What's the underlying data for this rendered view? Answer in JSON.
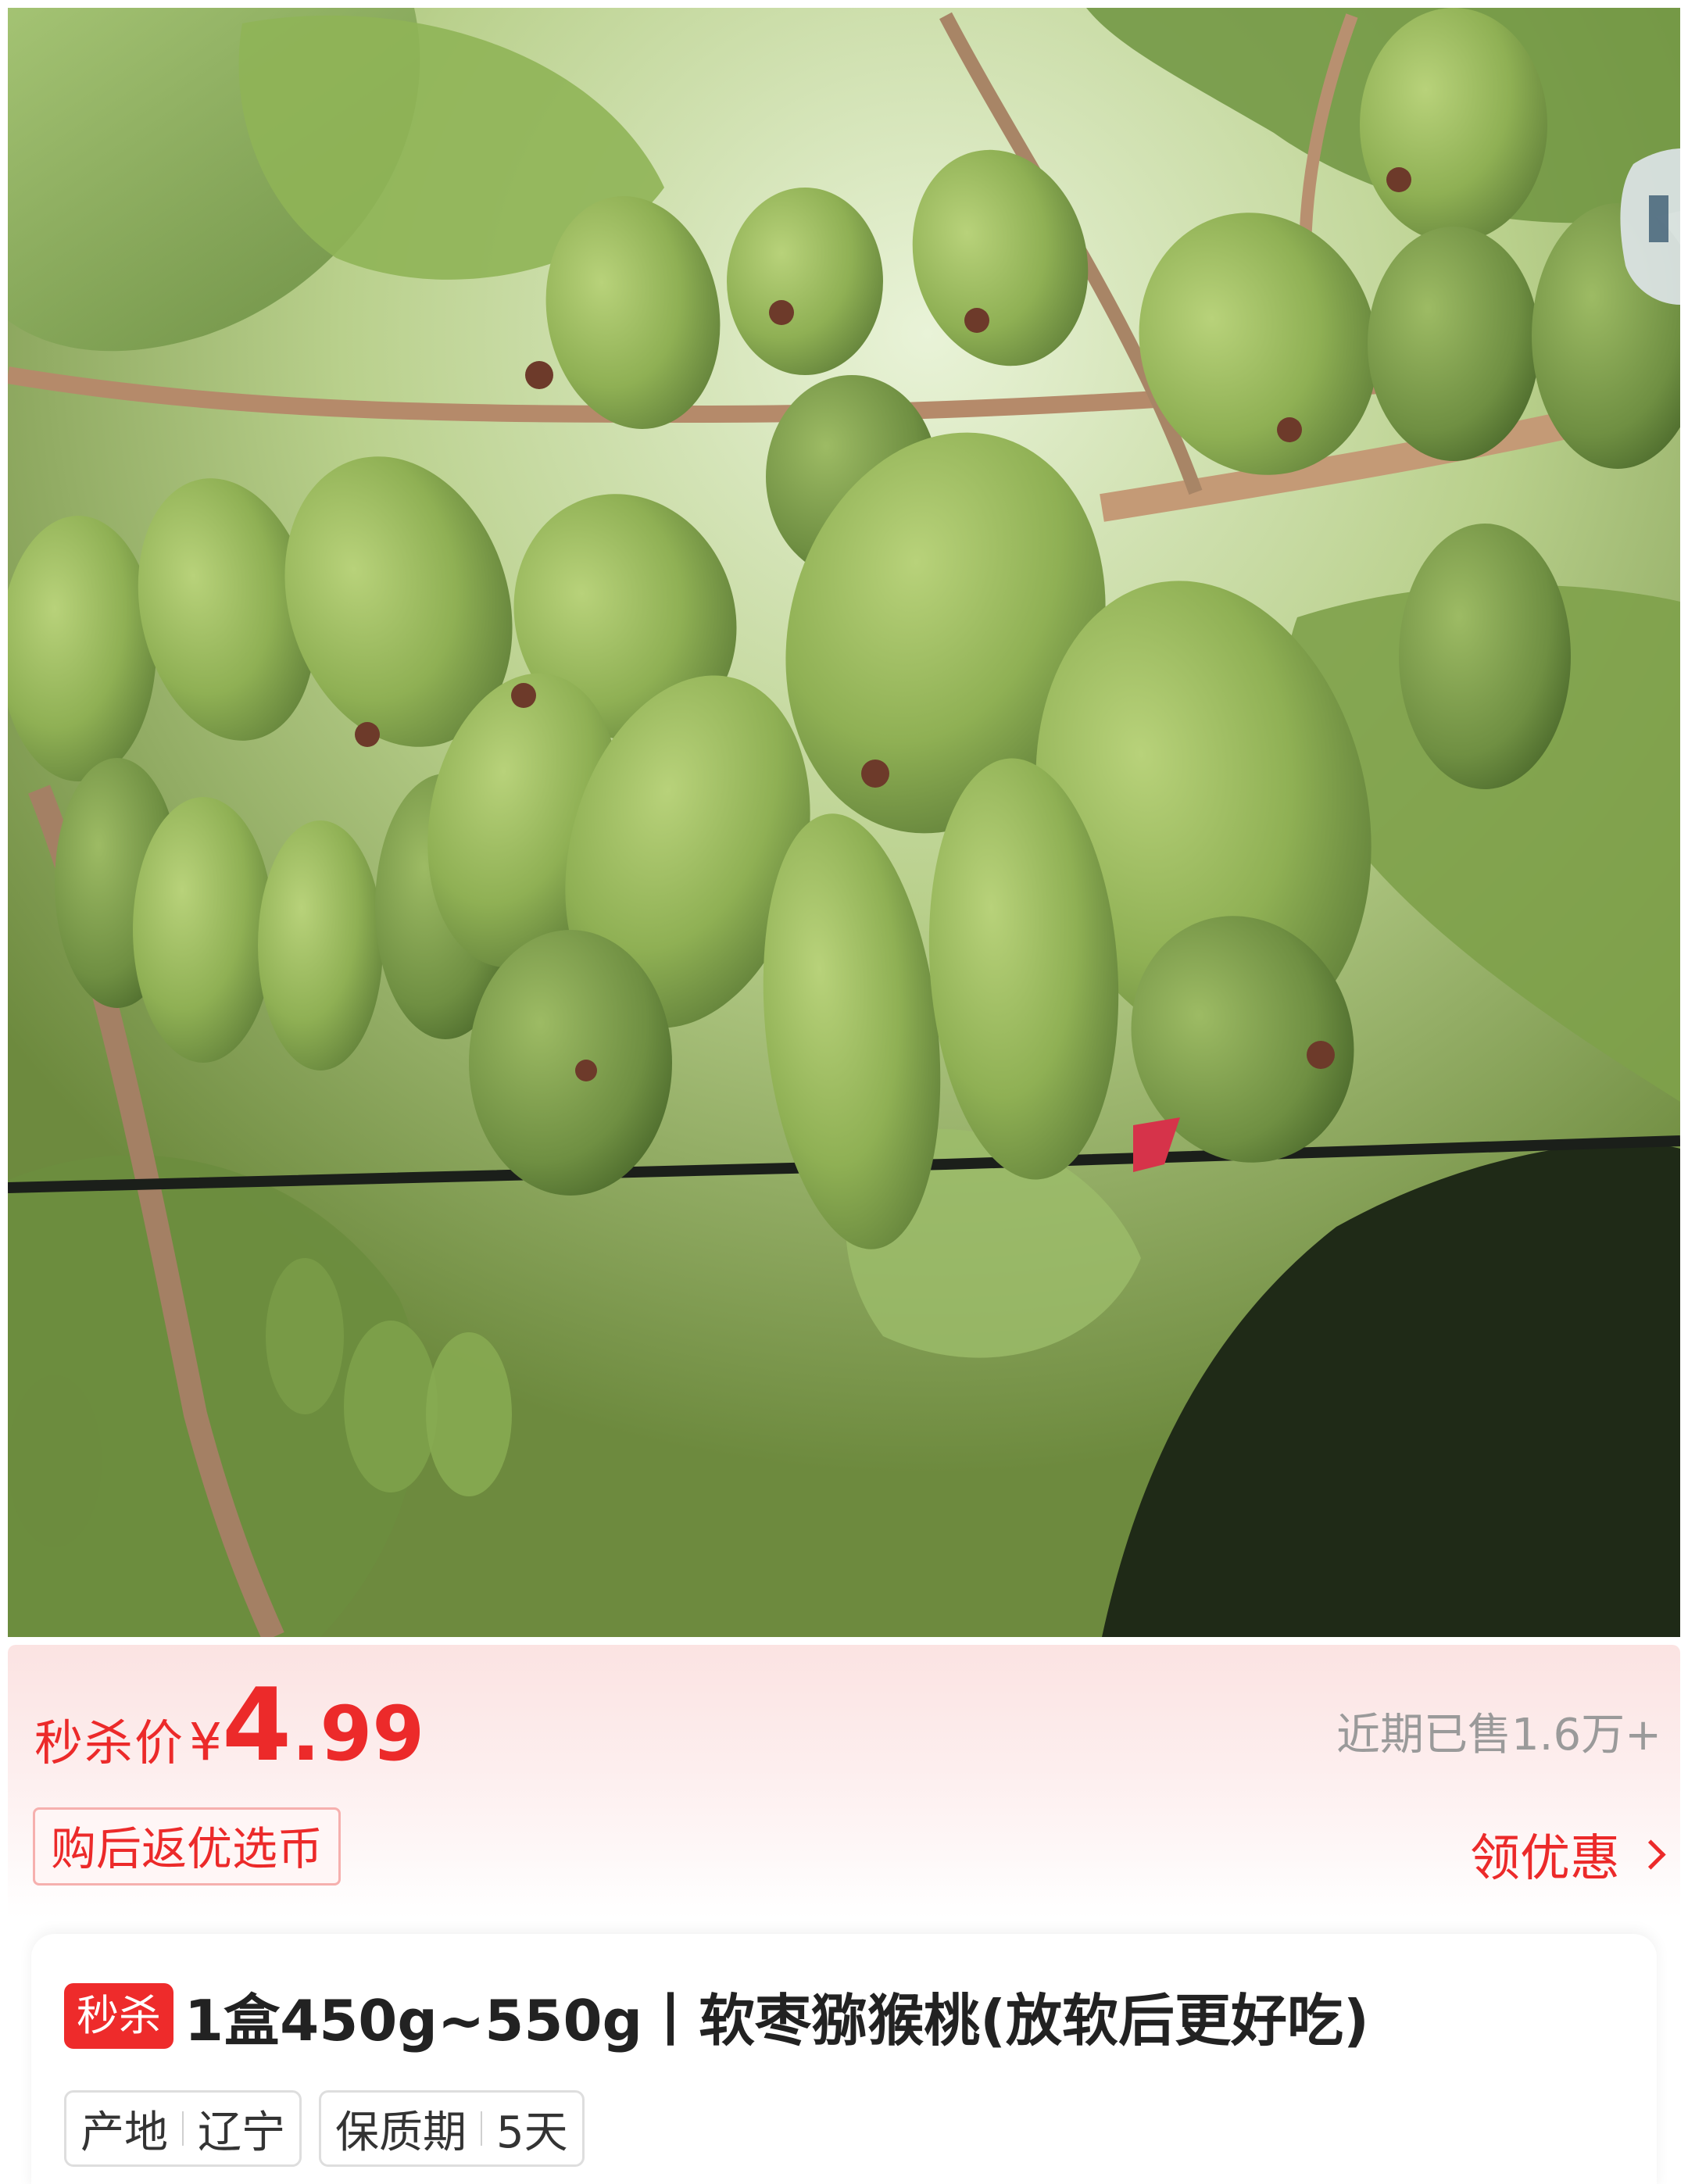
{
  "product": {
    "image_alt": "软枣猕猴桃",
    "price_label": "秒杀价",
    "currency": "¥",
    "price_int": "4",
    "price_dec": ".99",
    "sold": "近期已售1.6万+",
    "coin_tag": "购后返优选币",
    "coupon": "领优惠",
    "badge": "秒杀",
    "title": "1盒450g~550g丨软枣猕猴桃(放软后更好吃)",
    "attributes": [
      {
        "key": "产地",
        "value": "辽宁"
      },
      {
        "key": "保质期",
        "value": "5天"
      }
    ]
  },
  "colors": {
    "accent": "#ec2a2a",
    "muted": "#9a9a9a",
    "title": "#222222"
  }
}
